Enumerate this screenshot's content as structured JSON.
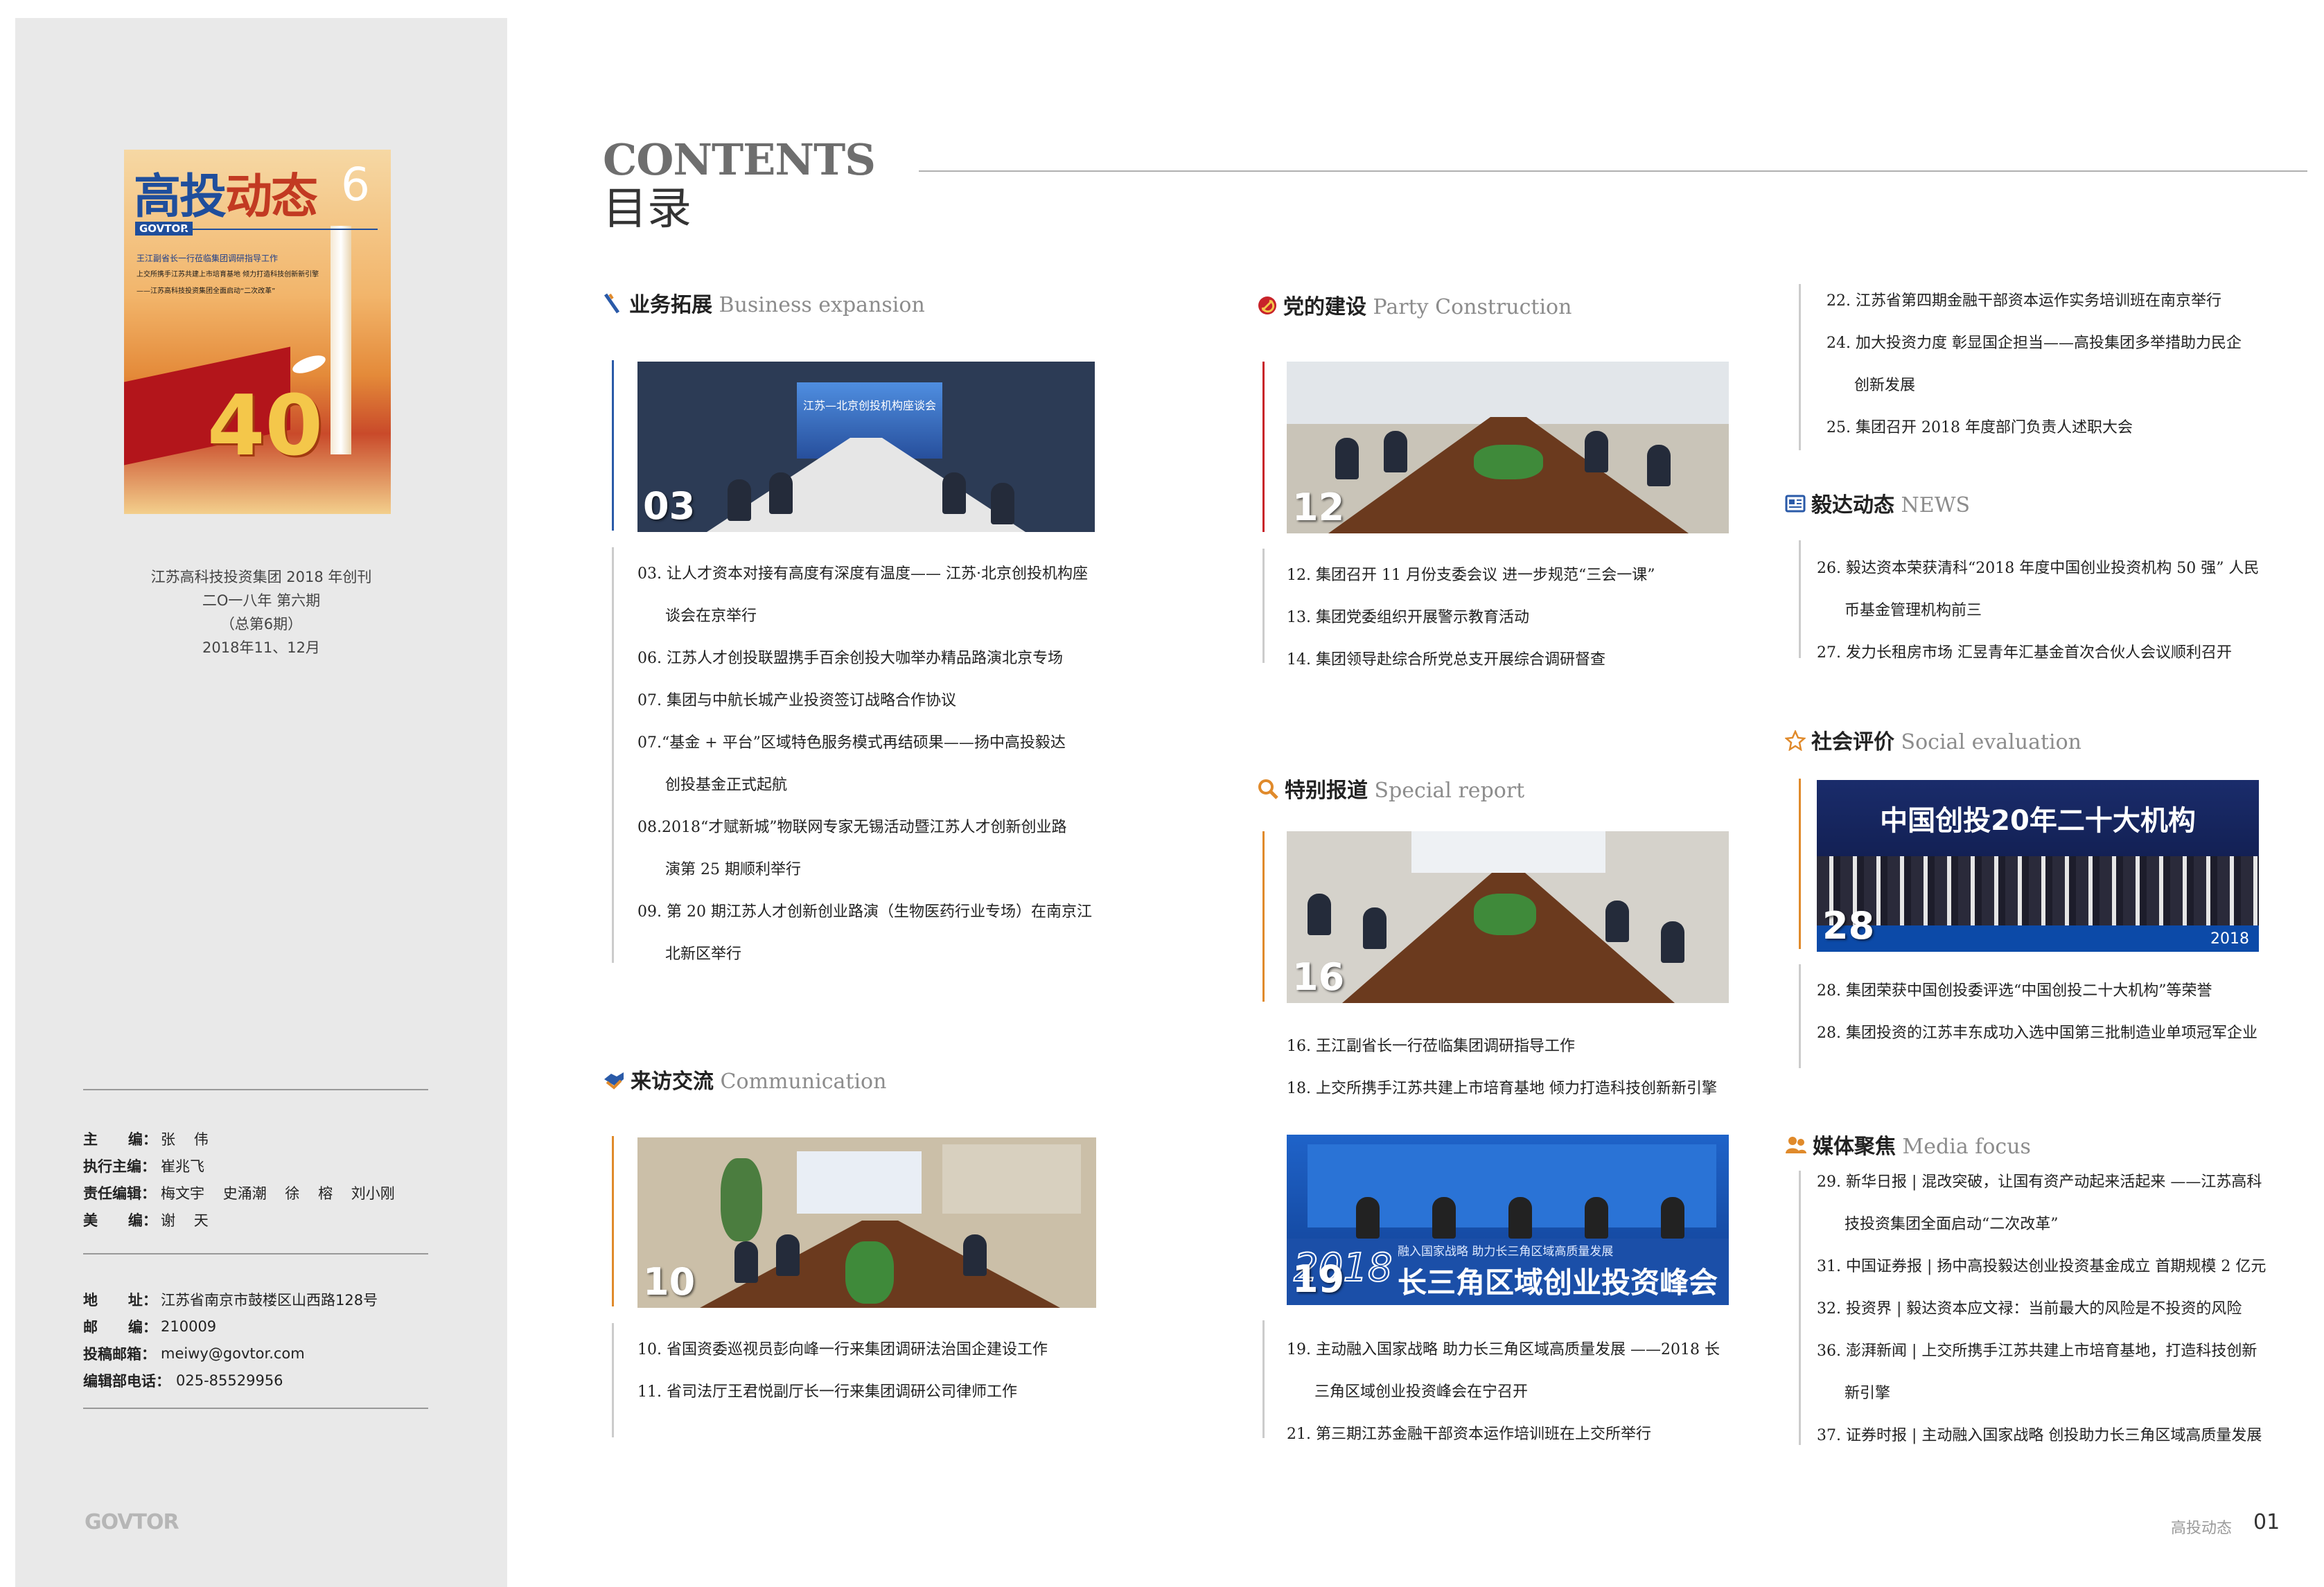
{
  "cover": {
    "masthead_a": "高投",
    "masthead_b": "动态",
    "issue_number": "6",
    "brand": "GOVTOR",
    "headline_1": "王江副省长一行莅临集团调研指导工作",
    "headline_2": "上交所携手江苏共建上市培育基地 倾力打造科技创新新引擎",
    "headline_3": "——江苏高科技投资集团全面启动“二次改革”",
    "figure_text": "40"
  },
  "pubinfo": [
    "江苏高科技投资集团  2018 年创刊",
    "二O一八年   第六期",
    "（总第6期）",
    "2018年11、12月"
  ],
  "staff": [
    {
      "key": "主      编：",
      "value": "张    伟"
    },
    {
      "key": "执行主编：",
      "value": "崔兆飞"
    },
    {
      "key": "责任编辑：",
      "value": "梅文宇    史涌潮    徐    榕    刘小刚"
    },
    {
      "key": "美      编：",
      "value": "谢    天"
    }
  ],
  "contact": [
    {
      "key": "地      址：",
      "value": "江苏省南京市鼓楼区山西路128号"
    },
    {
      "key": "邮      编：",
      "value": "210009"
    },
    {
      "key": "投稿邮箱：",
      "value": "meiwy@govtor.com"
    },
    {
      "key": "编辑部电话：",
      "value": "025-85529956"
    }
  ],
  "footer_logo": "GOVTOR",
  "header": {
    "contents_en": "CONTENTS",
    "contents_zh": "目录"
  },
  "sections": {
    "business": {
      "zh": "业务拓展",
      "en": "Business expansion",
      "color": "#2a5aa8",
      "badge": "03",
      "screen_text": "江苏—北京创投机构座谈会",
      "items": [
        "03. 让人才资本对接有高度有深度有温度—— 江苏·北京创投机构座",
        "谈会在京举行",
        "06. 江苏人才创投联盟携手百余创投大咖举办精品路演北京专场",
        "07. 集团与中航长城产业投资签订战略合作协议",
        "07.“基金 + 平台”区域特色服务模式再结硕果——扬中高投毅达",
        "创投基金正式起航",
        "08.2018“才赋新城”物联网专家无锡活动暨江苏人才创新创业路",
        "演第 25 期顺利举行",
        "09. 第 20 期江苏人才创新创业路演（生物医药行业专场）在南京江",
        "北新区举行"
      ]
    },
    "visits": {
      "zh": "来访交流",
      "en": "Communication",
      "color": "#e08a2b",
      "badge": "10",
      "items": [
        "10. 省国资委巡视员彭向峰一行来集团调研法治国企建设工作",
        "11. 省司法厅王君悦副厅长一行来集团调研公司律师工作"
      ]
    },
    "party": {
      "zh": "党的建设",
      "en": "Party Construction",
      "color": "#c8232a",
      "badge": "12",
      "items": [
        "12. 集团召开 11 月份支委会议 进一步规范“三会一课”",
        "13. 集团党委组织开展警示教育活动",
        "14. 集团领导赴综合所党总支开展综合调研督查"
      ]
    },
    "special": {
      "zh": "特别报道",
      "en": "Special report",
      "color": "#e08a2b",
      "badge": "16",
      "badge2": "19",
      "banner_2018": "2018",
      "banner_top": "融入国家战略  助力长三角区域高质量发展",
      "banner_main": "长三角区域创业投资峰会",
      "items_a": [
        "16. 王江副省长一行莅临集团调研指导工作",
        "18. 上交所携手江苏共建上市培育基地  倾力打造科技创新新引擎"
      ],
      "items_b": [
        "19. 主动融入国家战略 助力长三角区域高质量发展 ——2018 长",
        "三角区域创业投资峰会在宁召开",
        "21. 第三期江苏金融干部资本运作培训班在上交所举行"
      ]
    },
    "special_cont": {
      "items": [
        "22. 江苏省第四期金融干部资本运作实务培训班在南京举行",
        "24. 加大投资力度    彰显国企担当——高投集团多举措助力民企",
        "创新发展",
        "25. 集团召开 2018 年度部门负责人述职大会"
      ]
    },
    "news": {
      "zh": "毅达动态",
      "en": "NEWS",
      "color": "#2a5aa8",
      "items": [
        "26. 毅达资本荣获清科“2018 年度中国创业投资机构 50 强” 人民",
        "币基金管理机构前三",
        "27. 发力长租房市场 汇昱青年汇基金首次合伙人会议顺利召开"
      ]
    },
    "social": {
      "zh": "社会评价",
      "en": "Social evaluation",
      "color": "#e08a2b",
      "badge": "28",
      "banner": "中国创投20年二十大机构",
      "stage_year": "2018",
      "items": [
        "28. 集团荣获中国创投委评选“中国创投二十大机构”等荣誉",
        "28. 集团投资的江苏丰东成功入选中国第三批制造业单项冠军企业"
      ]
    },
    "media": {
      "zh": "媒体聚焦",
      "en": "Media focus",
      "color": "#e08a2b",
      "items": [
        "29. 新华日报 | 混改突破，让国有资产动起来活起来 ——江苏高科",
        "技投资集团全面启动“二次改革”",
        "31. 中国证券报 | 扬中高投毅达创业投资基金成立 首期规模 2 亿元",
        "32. 投资界 | 毅达资本应文禄：当前最大的风险是不投资的风险",
        "36. 澎湃新闻 | 上交所携手江苏共建上市培育基地，打造科技创新",
        "新引擎",
        "37. 证券时报 | 主动融入国家战略 创投助力长三角区域高质量发展"
      ]
    }
  },
  "footer": {
    "brand": "高投动态",
    "page": "01"
  }
}
